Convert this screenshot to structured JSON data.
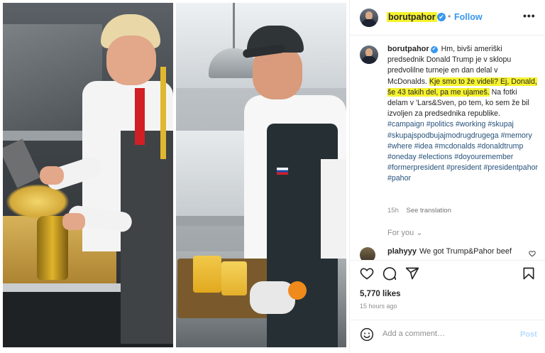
{
  "header": {
    "username": "borutpahor",
    "verified_glyph": "✔",
    "separator": "•",
    "follow_label": "Follow",
    "more_glyph": "•••"
  },
  "caption": {
    "username": "borutpahor",
    "text_1": "Hm, bivši ameriški predsednik Donald Trump je v sklopu predvolilne turneje en dan delal v McDonalds. ",
    "text_highlight": "Kje smo to že videli? Ej, Donald, še 43 takih del, pa me ujameš.",
    "text_2": " Na fotki delam v 'Lars&Sven, po tem, ko sem že bil izvoljen za predsednika republike.",
    "hashtags": "#campaign #politics #working #skupaj #skupajspodbujajmodrugdrugega #memory #where #idea #mcdonalds #donaldtrump #oneday #elections #doyouremember #formerpresident #president #presidentpahor #pahor",
    "time": "15h",
    "see_translation": "See translation"
  },
  "for_you": "For you ⌄",
  "comment": {
    "username": "plahyyy",
    "text": "We got Trump&Pahor beef"
  },
  "actions": {
    "icons": [
      "heart-icon",
      "comment-icon",
      "share-icon",
      "bookmark-icon"
    ]
  },
  "likes": "5,770 likes",
  "time_ago": "15 hours ago",
  "add_comment": {
    "placeholder": "Add a comment…",
    "post_label": "Post"
  },
  "photos": {
    "left_alt": "Donald Trump working at McDonald's fryer",
    "right_alt": "Borut Pahor working at Lars&Sven"
  },
  "colors": {
    "highlight": "#f6f32e",
    "accent": "#3897f0",
    "hashtag": "#26517a",
    "post_disabled": "#b3dbff"
  }
}
